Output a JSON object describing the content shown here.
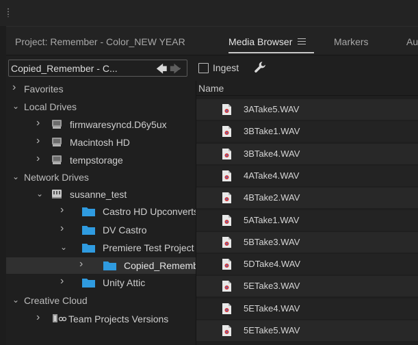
{
  "tabs": [
    {
      "label": "Project: Remember - Color_NEW YEAR",
      "active": false
    },
    {
      "label": "Media Browser",
      "active": true
    },
    {
      "label": "Markers",
      "active": false
    },
    {
      "label": "Au",
      "active": false
    }
  ],
  "toolbar": {
    "path": "Copied_Remember - C...",
    "ingest_label": "Ingest",
    "ingest_checked": false
  },
  "tree": [
    {
      "label": "Favorites",
      "type": "header",
      "expanded": false
    },
    {
      "label": "Local Drives",
      "type": "header",
      "expanded": true
    },
    {
      "label": "firmwaresyncd.D6y5ux",
      "type": "drive",
      "expanded": false
    },
    {
      "label": "Macintosh HD",
      "type": "drive",
      "expanded": false
    },
    {
      "label": "tempstorage",
      "type": "drive",
      "expanded": false
    },
    {
      "label": "Network Drives",
      "type": "header",
      "expanded": true
    },
    {
      "label": "susanne_test",
      "type": "network-drive",
      "expanded": true
    },
    {
      "label": "Castro HD Upconverts",
      "type": "folder",
      "expanded": false
    },
    {
      "label": "DV Castro",
      "type": "folder",
      "expanded": false
    },
    {
      "label": "Premiere Test Project",
      "type": "folder",
      "expanded": true
    },
    {
      "label": "Copied_Rememb",
      "type": "folder",
      "expanded": false,
      "selected": true
    },
    {
      "label": "Unity Attic",
      "type": "folder",
      "expanded": false
    },
    {
      "label": "Creative Cloud",
      "type": "header",
      "expanded": true
    },
    {
      "label": "Team Projects Versions",
      "type": "team",
      "expanded": false
    }
  ],
  "files": {
    "column_name": "Name",
    "items": [
      "3ATake5.WAV",
      "3BTake1.WAV",
      "3BTake4.WAV",
      "4ATake4.WAV",
      "4BTake2.WAV",
      "5ATake1.WAV",
      "5BTake3.WAV",
      "5DTake4.WAV",
      "5ETake3.WAV",
      "5ETake4.WAV",
      "5ETake5.WAV"
    ]
  },
  "colors": {
    "folder": "#2f9be0",
    "accent_underline": "#c8c8c8",
    "selected_row": "#303030"
  }
}
